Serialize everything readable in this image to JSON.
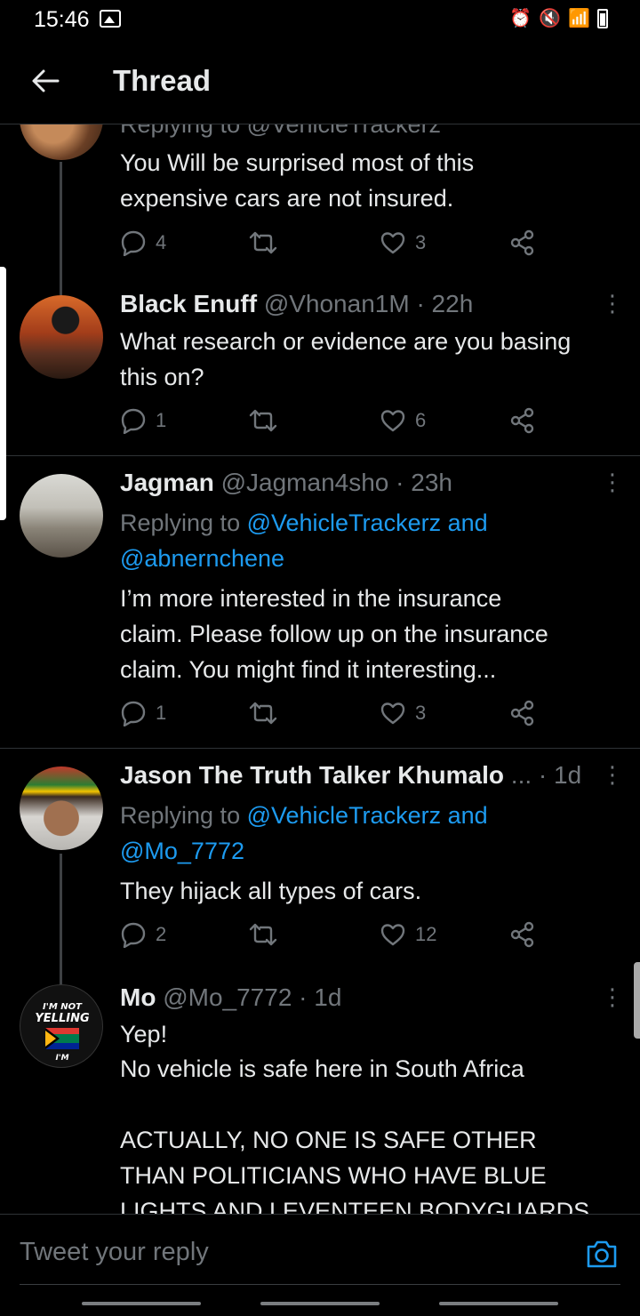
{
  "status_bar": {
    "time": "15:46"
  },
  "header": {
    "title": "Thread"
  },
  "tweets": [
    {
      "reply_to": "Replying to @VehicleTrackerz",
      "text_lines": [
        "You Will be surprised most of this",
        "expensive cars are not insured."
      ],
      "replies": "4",
      "likes": "3"
    },
    {
      "name": "Black Enuff",
      "meta": "@Vhonan1M · 22h",
      "text_lines": [
        "What research or evidence are you basing",
        "this on?"
      ],
      "replies": "1",
      "likes": "6"
    },
    {
      "name": "Jagman",
      "meta": "@Jagman4sho · 23h",
      "reply_prefix": "Replying to ",
      "reply_line1_link": "@VehicleTrackerz and",
      "reply_line2_link": "@abnernchene",
      "text_lines": [
        "I’m more interested in the insurance",
        "claim. Please follow up on the insurance",
        "claim. You might find it interesting..."
      ],
      "replies": "1",
      "likes": "3"
    },
    {
      "name": "Jason The Truth Talker Khumalo",
      "meta": "... · 1d",
      "reply_prefix": "Replying to ",
      "reply_line1_link": "@VehicleTrackerz and",
      "reply_line2_link": "@Mo_7772",
      "text_lines": [
        "They hijack all types of cars."
      ],
      "replies": "2",
      "likes": "12"
    },
    {
      "name": "Mo",
      "meta": "@Mo_7772 · 1d",
      "avatar_text": [
        "I'M NOT",
        "YELLING",
        "I'M"
      ],
      "text_lines": [
        "Yep!",
        "No vehicle is safe here in South Africa",
        "",
        "ACTUALLY, NO ONE IS SAFE OTHER",
        "THAN POLITICIANS WHO HAVE BLUE",
        "LIGHTS AND LEVENTEEN BODYGUARDS"
      ]
    }
  ],
  "reply_bar": {
    "placeholder": "Tweet your reply"
  },
  "colors": {
    "background": "#000000",
    "text": "#e7e9ea",
    "muted": "#71767b",
    "link": "#1d9bf0",
    "divider": "#2f3336"
  },
  "icons": [
    "back-arrow-icon",
    "reply-icon",
    "retweet-icon",
    "like-icon",
    "share-icon",
    "more-icon",
    "camera-icon"
  ]
}
